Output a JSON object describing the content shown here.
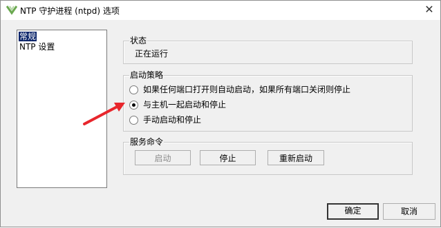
{
  "window": {
    "title": "NTP 守护进程 (ntpd) 选项",
    "icon": "vsphere-logo-icon",
    "close_glyph": "✕"
  },
  "sidebar": {
    "items": [
      {
        "label": "常规",
        "selected": true
      },
      {
        "label": "NTP 设置",
        "selected": false
      }
    ]
  },
  "status_group": {
    "legend": "状态",
    "value": "正在运行"
  },
  "policy_group": {
    "legend": "启动策略",
    "options": [
      {
        "label": "如果任何端口打开则自动启动，如果所有端口关闭则停止",
        "checked": false
      },
      {
        "label": "与主机一起启动和停止",
        "checked": true
      },
      {
        "label": "手动启动和停止",
        "checked": false
      }
    ]
  },
  "service_group": {
    "legend": "服务命令",
    "start_label": "启动",
    "stop_label": "停止",
    "restart_label": "重新启动"
  },
  "footer": {
    "ok_label": "确定",
    "cancel_label": "取消"
  },
  "colors": {
    "annotation_arrow": "#e8262c",
    "selection": "#0a246a"
  }
}
